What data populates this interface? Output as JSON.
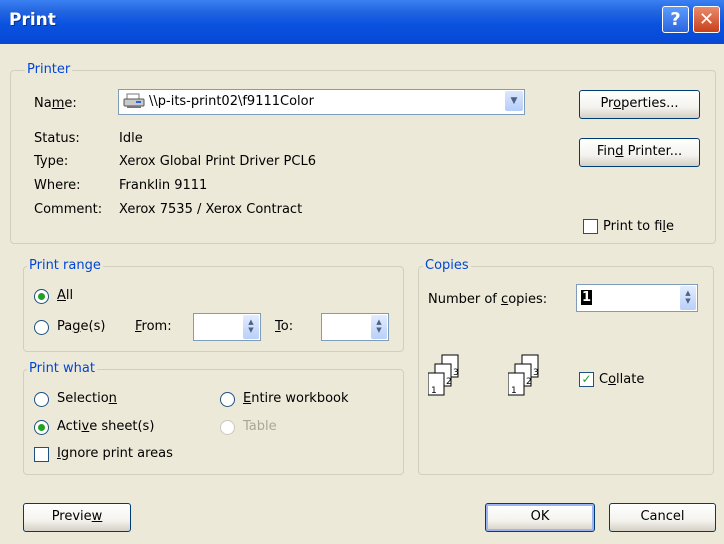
{
  "titlebar": {
    "title": "Print",
    "help_glyph": "?",
    "close_glyph": "✕"
  },
  "printer_group": {
    "legend": "Printer",
    "name_label": "Name:",
    "name_value": "\\\\p-its-print02\\f9111Color",
    "status_label": "Status:",
    "status_value": "Idle",
    "type_label": "Type:",
    "type_value": "Xerox Global Print Driver PCL6",
    "where_label": "Where:",
    "where_value": "Franklin 9111",
    "comment_label": "Comment:",
    "comment_value": "Xerox 7535 / Xerox Contract",
    "properties_button": "Properties...",
    "find_printer_button": "Find Printer...",
    "print_to_file_label": "Print to file",
    "print_to_file_checked": false
  },
  "print_range": {
    "legend": "Print range",
    "all_label": "All",
    "pages_label": "Page(s)",
    "from_label": "From:",
    "to_label": "To:",
    "from_value": "",
    "to_value": "",
    "selected": "All"
  },
  "print_what": {
    "legend": "Print what",
    "selection_label": "Selection",
    "entire_workbook_label": "Entire workbook",
    "active_sheets_label": "Active sheet(s)",
    "table_label": "Table",
    "ignore_print_areas_label": "Ignore print areas",
    "selected": "Active sheet(s)",
    "ignore_print_areas_checked": false
  },
  "copies": {
    "legend": "Copies",
    "number_label": "Number of copies:",
    "number_value": "1",
    "collate_label": "Collate",
    "collate_checked": true,
    "collate_icon": "collate-pages-icon",
    "page_numbers": [
      "1",
      "2",
      "3"
    ]
  },
  "footer": {
    "preview_button": "Preview",
    "ok_button": "OK",
    "cancel_button": "Cancel"
  },
  "colors": {
    "title_blue": "#0a52e0",
    "group_label_blue": "#0046d5",
    "dialog_bg": "#ece9d8",
    "check_green": "#21a121"
  }
}
